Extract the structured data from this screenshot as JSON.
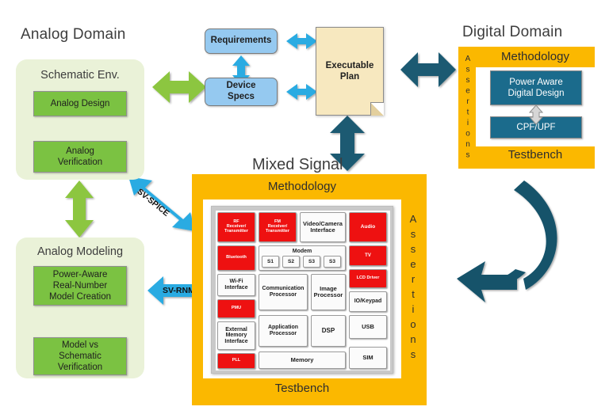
{
  "analog_domain": {
    "title": "Analog Domain",
    "schematic_env": {
      "heading": "Schematic Env.",
      "boxes": [
        {
          "label": "Analog Design"
        },
        {
          "label": "Analog\nVerification"
        }
      ]
    },
    "analog_modeling": {
      "heading": "Analog Modeling",
      "boxes": [
        {
          "label": "Power-Aware\nReal-Number\nModel Creation"
        },
        {
          "label": "Model vs\nSchematic\nVerification"
        }
      ]
    }
  },
  "planning": {
    "requirements": "Requirements",
    "device_specs": "Device\nSpecs",
    "executable_plan": "Executable\nPlan"
  },
  "digital_domain": {
    "title": "Digital Domain",
    "methodology": "Methodology",
    "testbench": "Testbench",
    "assertions": "Assertions",
    "boxes": [
      {
        "label": "Power Aware\nDigital Design"
      },
      {
        "label": "CPF/UPF"
      }
    ]
  },
  "mixed_signal": {
    "title": "Mixed Signal",
    "methodology": "Methodology",
    "testbench": "Testbench",
    "assertions": "Assertions",
    "chip_blocks": [
      {
        "label": "RF\nReceiver/\nTransmitter",
        "color": "red"
      },
      {
        "label": "FM\nReceiver/\nTransmitter",
        "color": "red"
      },
      {
        "label": "Video/Camera\nInterface",
        "color": "white"
      },
      {
        "label": "Audio",
        "color": "red"
      },
      {
        "label": "Bluetooth",
        "color": "red"
      },
      {
        "label": "Modem",
        "color": "group"
      },
      {
        "label": "TV",
        "color": "red"
      },
      {
        "label": "Wi-Fi\nInterface",
        "color": "white"
      },
      {
        "label": "Communication\nProcessor",
        "color": "white"
      },
      {
        "label": "Image\nProcessor",
        "color": "white"
      },
      {
        "label": "LCD Driver",
        "color": "red"
      },
      {
        "label": "PMU",
        "color": "red"
      },
      {
        "label": "IO/Keypad",
        "color": "white"
      },
      {
        "label": "External\nMemory\nInterface",
        "color": "white"
      },
      {
        "label": "Application\nProcessor",
        "color": "white"
      },
      {
        "label": "DSP",
        "color": "white"
      },
      {
        "label": "USB",
        "color": "white"
      },
      {
        "label": "PLL",
        "color": "red"
      },
      {
        "label": "Memory",
        "color": "white"
      },
      {
        "label": "SIM",
        "color": "white"
      }
    ],
    "modem_slots": [
      "S1",
      "S2",
      "S3",
      "S3"
    ]
  },
  "connectors": {
    "sv_spice": "SV-SPICE",
    "sv_rnm": "SV-RNM"
  },
  "colors": {
    "orange": "#fbb800",
    "green": "#7bc242",
    "light_green_panel": "#eaf2d8",
    "blue": "#95c9f0",
    "cyan_arrow": "#29abe2",
    "teal": "#1b6b8c",
    "red": "#ee1111",
    "document": "#f7e8bf",
    "green_arrow": "#8cc63f"
  }
}
